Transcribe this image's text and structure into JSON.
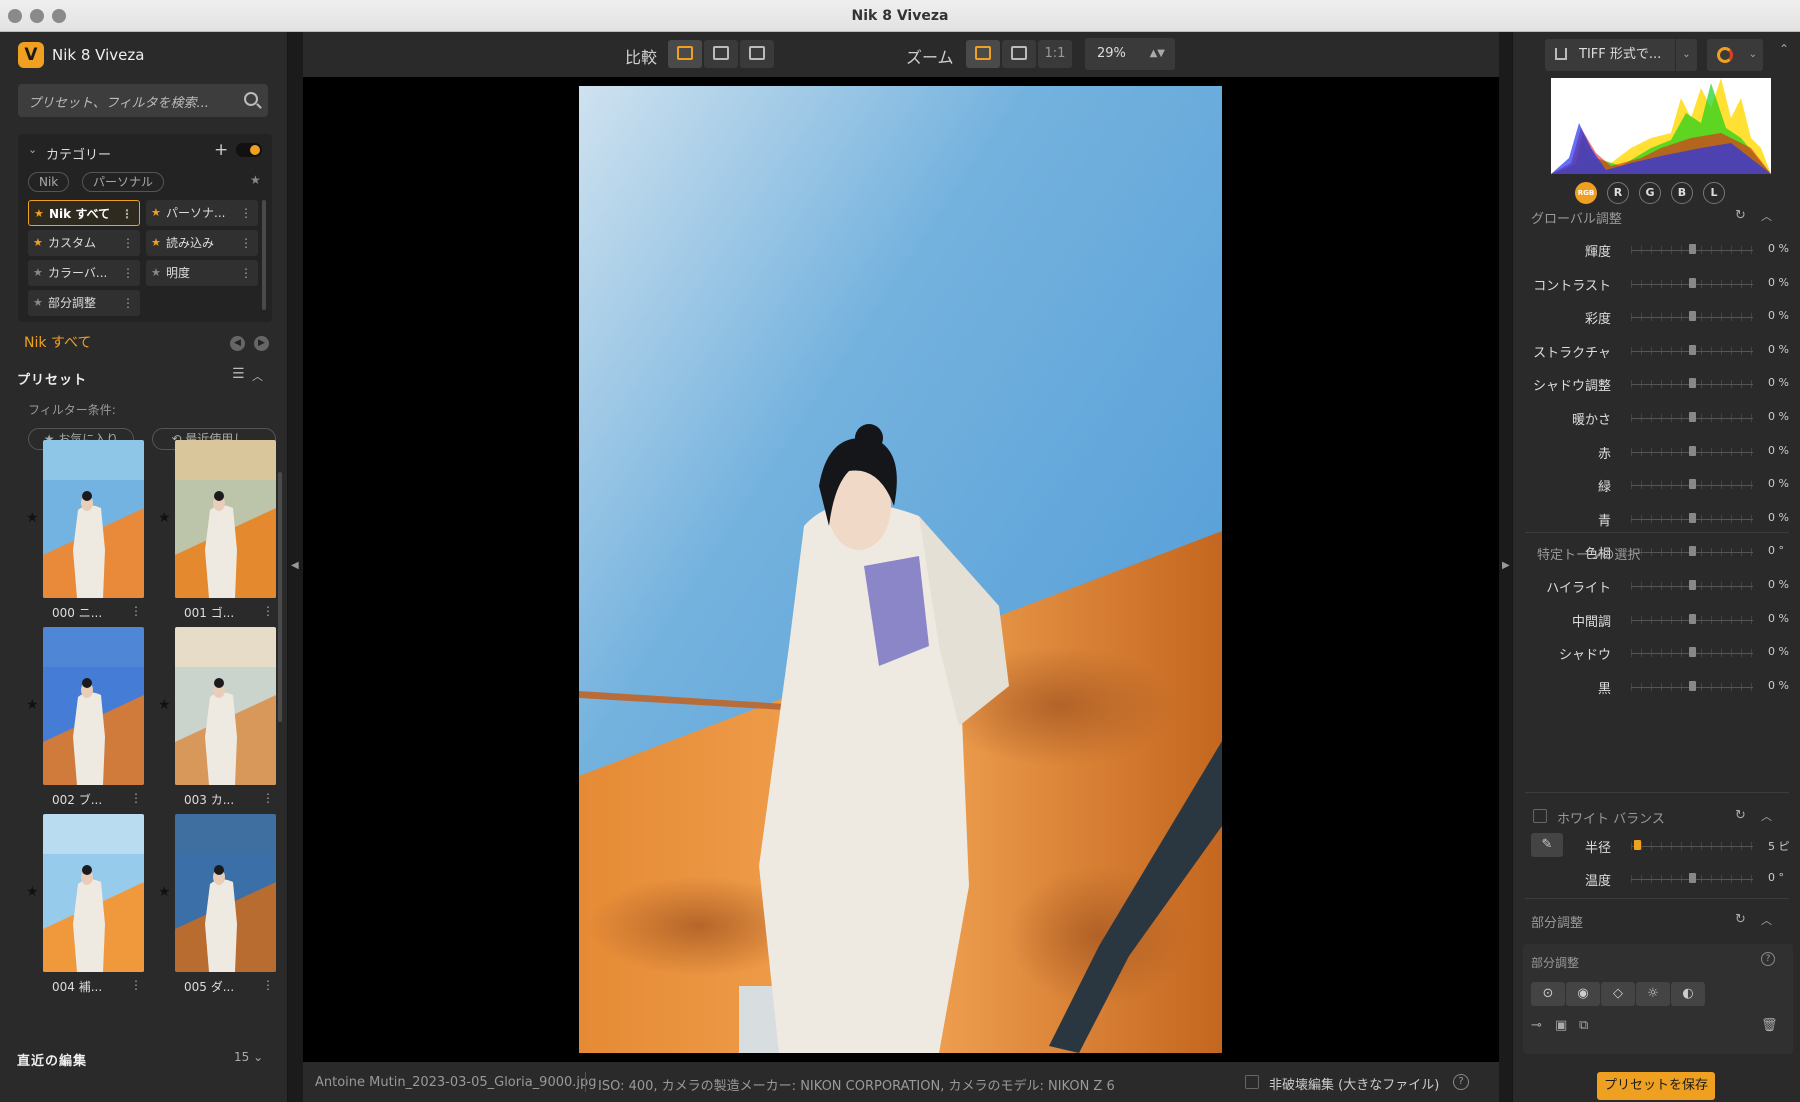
{
  "window": {
    "title": "Nik 8 Viveza"
  },
  "app": {
    "name": "Nik 8 Viveza",
    "logo_letter": "V",
    "accent": "#f0a020"
  },
  "search": {
    "placeholder": "プリセット、フィルタを検索..."
  },
  "categories": {
    "title": "カテゴリー",
    "chips": [
      "Nik",
      "パーソナル"
    ],
    "items": [
      {
        "label": "Nik すべて",
        "star": "gold",
        "selected": true
      },
      {
        "label": "パーソナ...",
        "star": "gold"
      },
      {
        "label": "カスタム",
        "star": "gold"
      },
      {
        "label": "読み込み",
        "star": "gold"
      },
      {
        "label": "カラーバ...",
        "star": "dark"
      },
      {
        "label": "明度",
        "star": "dark"
      },
      {
        "label": "部分調整",
        "star": "dark"
      }
    ]
  },
  "current_category": "Nik すべて",
  "presets": {
    "title": "プリセット",
    "filter_label": "フィルター条件:",
    "filters": [
      "★ お気に入り",
      "⟲ 最近使用し..."
    ],
    "thumbs": [
      {
        "name": "000 ニ...",
        "tone": "original"
      },
      {
        "name": "001 ゴ...",
        "tone": "golden"
      },
      {
        "name": "002 ブ...",
        "tone": "blue"
      },
      {
        "name": "003 カ...",
        "tone": "faded"
      },
      {
        "name": "004 補...",
        "tone": "bright"
      },
      {
        "name": "005 ダ...",
        "tone": "dark"
      }
    ]
  },
  "recent": {
    "title": "直近の編集",
    "count": "15 ⌄"
  },
  "toolbar": {
    "compare_label": "比較",
    "zoom_label": "ズーム",
    "zoom_one": "1:1",
    "zoom_value": "29%"
  },
  "status": {
    "filename": "Antoine Mutin_2023-03-05_Gloria_9000.jpg",
    "info": "ISO: 400, カメラの製造メーカー: NIKON CORPORATION, カメラのモデル: NIKON Z 6",
    "nondestructive_label": "非破壊編集 (大きなファイル)",
    "help": "?"
  },
  "export": {
    "label": "TIFF 形式で..."
  },
  "histogram": {
    "channels": [
      "RGB",
      "R",
      "G",
      "B",
      "L"
    ],
    "active": "RGB"
  },
  "global": {
    "title": "グローバル調整",
    "sliders": [
      {
        "label": "輝度",
        "value": "0 %",
        "pos": 0.5
      },
      {
        "label": "コントラスト",
        "value": "0 %",
        "pos": 0.5
      },
      {
        "label": "彩度",
        "value": "0 %",
        "pos": 0.5
      },
      {
        "label": "ストラクチャ",
        "value": "0 %",
        "pos": 0.5
      },
      {
        "label": "シャドウ調整",
        "value": "0 %",
        "pos": 0.5
      },
      {
        "label": "暖かさ",
        "value": "0 %",
        "pos": 0.5
      },
      {
        "label": "赤",
        "value": "0 %",
        "pos": 0.5
      },
      {
        "label": "緑",
        "value": "0 %",
        "pos": 0.5
      },
      {
        "label": "青",
        "value": "0 %",
        "pos": 0.5
      },
      {
        "label": "色相",
        "value": "0 °",
        "pos": 0.5
      }
    ]
  },
  "tones": {
    "title": "特定トーンの選択",
    "sliders": [
      {
        "label": "ハイライト",
        "value": "0 %",
        "pos": 0.5
      },
      {
        "label": "中間調",
        "value": "0 %",
        "pos": 0.5
      },
      {
        "label": "シャドウ",
        "value": "0 %",
        "pos": 0.5
      },
      {
        "label": "黒",
        "value": "0 %",
        "pos": 0.5
      }
    ]
  },
  "whitebalance": {
    "title": "ホワイト バランス",
    "sliders": [
      {
        "label": "半径",
        "value": "5 ピ",
        "pos": 0.05,
        "gold": true
      },
      {
        "label": "温度",
        "value": "0 °",
        "pos": 0.5
      }
    ]
  },
  "local": {
    "title": "部分調整",
    "box_title": "部分調整",
    "help": "?",
    "tools": [
      "⊙",
      "◉",
      "◇",
      "☼",
      "◐"
    ],
    "small_tools": [
      "⊸",
      "▣",
      "⧉"
    ],
    "trash": "🗑"
  },
  "save": {
    "label": "プリセットを保存"
  }
}
